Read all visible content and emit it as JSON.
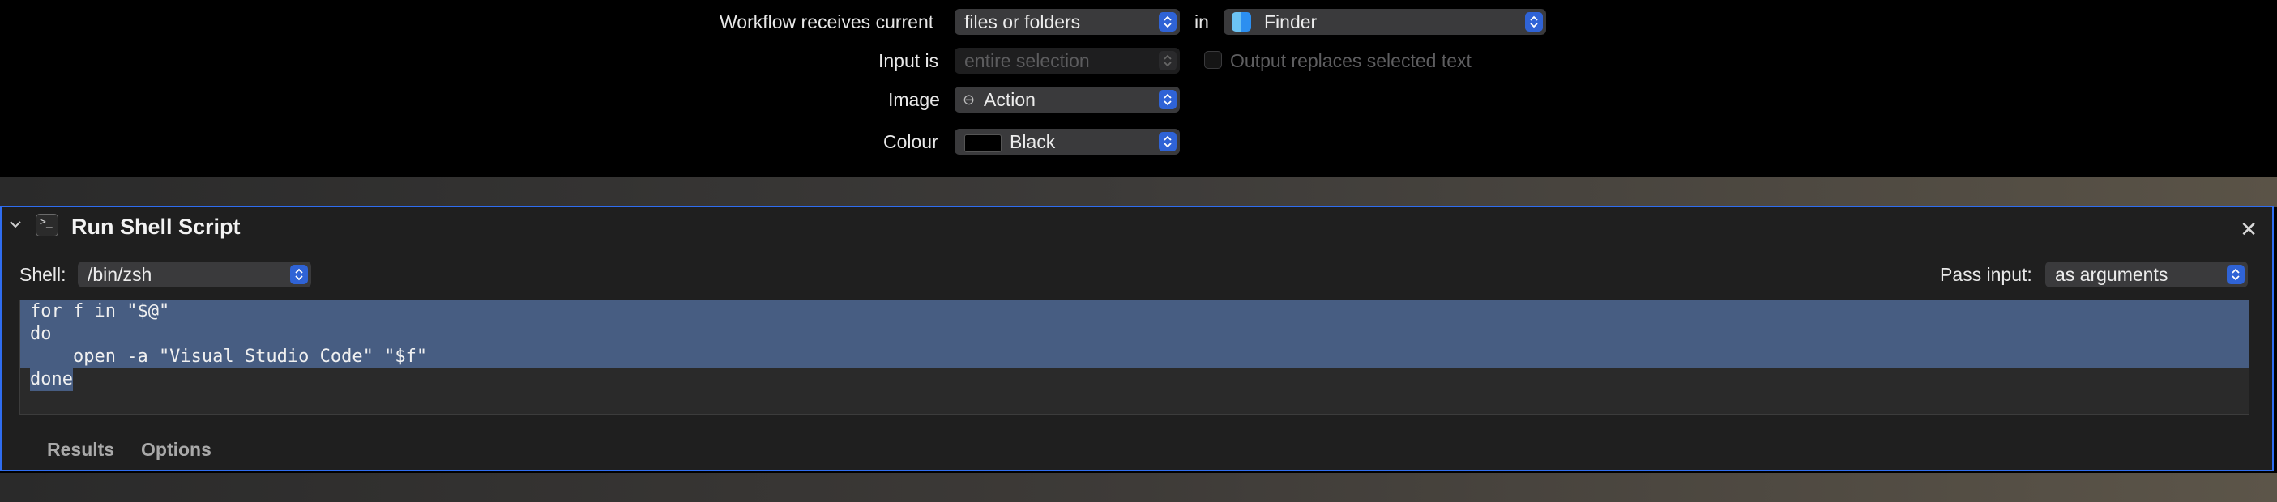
{
  "workflow": {
    "receives_label": "Workflow receives current",
    "receives_value": "files or folders",
    "in_label": "in",
    "app_value": "Finder",
    "input_is_label": "Input is",
    "input_is_value": "entire selection",
    "output_replaces_label": "Output replaces selected text",
    "output_replaces_checked": false,
    "image_label": "Image",
    "image_value": "Action",
    "colour_label": "Colour",
    "colour_value": "Black",
    "colour_swatch": "#000000"
  },
  "action": {
    "title": "Run Shell Script",
    "shell_label": "Shell:",
    "shell_value": "/bin/zsh",
    "pass_input_label": "Pass input:",
    "pass_input_value": "as arguments",
    "script_lines": [
      "for f in \"$@\"",
      "do",
      "    open -a \"Visual Studio Code\" \"$f\"",
      "done"
    ],
    "tabs": [
      "Results",
      "Options"
    ]
  },
  "colors": {
    "accent": "#2f6df0",
    "selection": "#475d82",
    "popup_bg": "#3a3a3c"
  }
}
